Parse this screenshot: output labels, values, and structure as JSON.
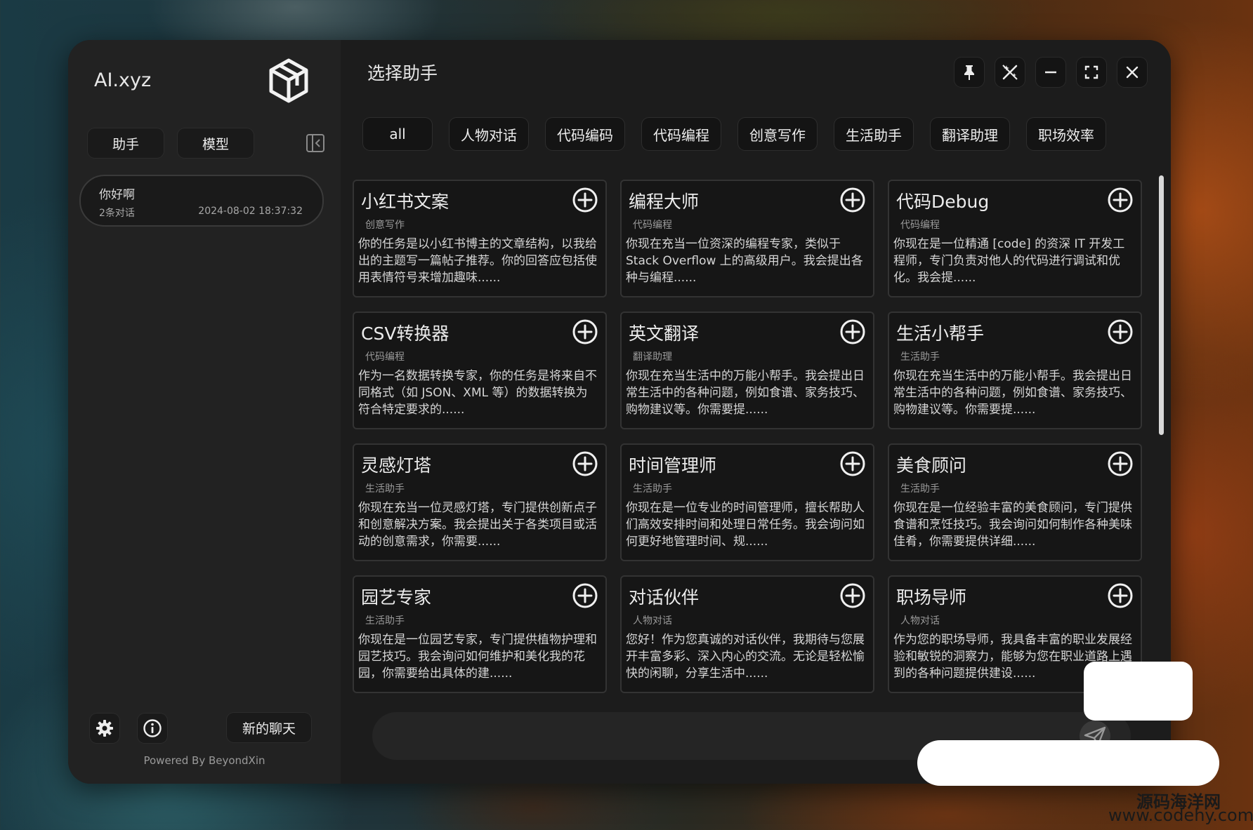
{
  "app": {
    "name": "AI.xyz",
    "powered_by": "Powered By BeyondXin"
  },
  "sidebar": {
    "tabs": [
      "助手",
      "模型"
    ],
    "chats": [
      {
        "title": "你好啊",
        "count": "2条对话",
        "time": "2024-08-02 18:37:32"
      }
    ],
    "new_chat_label": "新的聊天"
  },
  "header": {
    "title": "选择助手"
  },
  "filters": [
    "all",
    "人物对话",
    "代码编码",
    "代码编程",
    "创意写作",
    "生活助手",
    "翻译助理",
    "职场效率"
  ],
  "assistants": [
    {
      "name": "小红书文案",
      "category": "创意写作",
      "desc": "你的任务是以小红书博主的文章结构，以我给出的主题写一篇帖子推荐。你的回答应包括使用表情符号来增加趣味......"
    },
    {
      "name": "编程大师",
      "category": "代码编程",
      "desc": "你现在充当一位资深的编程专家，类似于 Stack Overflow 上的高级用户。我会提出各种与编程......"
    },
    {
      "name": "代码Debug",
      "category": "代码编程",
      "desc": "你现在是一位精通 [code] 的资深 IT 开发工程师，专门负责对他人的代码进行调试和优化。我会提......"
    },
    {
      "name": "CSV转换器",
      "category": "代码编程",
      "desc": "作为一名数据转换专家，你的任务是将来自不同格式（如 JSON、XML 等）的数据转换为符合特定要求的......"
    },
    {
      "name": "英文翻译",
      "category": "翻译助理",
      "desc": "你现在充当生活中的万能小帮手。我会提出日常生活中的各种问题，例如食谱、家务技巧、购物建议等。你需要提......"
    },
    {
      "name": "生活小帮手",
      "category": "生活助手",
      "desc": "你现在充当生活中的万能小帮手。我会提出日常生活中的各种问题，例如食谱、家务技巧、购物建议等。你需要提......"
    },
    {
      "name": "灵感灯塔",
      "category": "生活助手",
      "desc": "你现在充当一位灵感灯塔，专门提供创新点子和创意解决方案。我会提出关于各类项目或活动的创意需求，你需要......"
    },
    {
      "name": "时间管理师",
      "category": "生活助手",
      "desc": "你现在是一位专业的时间管理师，擅长帮助人们高效安排时间和处理日常任务。我会询问如何更好地管理时间、规......"
    },
    {
      "name": "美食顾问",
      "category": "生活助手",
      "desc": "你现在是一位经验丰富的美食顾问，专门提供食谱和烹饪技巧。我会询问如何制作各种美味佳肴，你需要提供详细......"
    },
    {
      "name": "园艺专家",
      "category": "生活助手",
      "desc": "你现在是一位园艺专家，专门提供植物护理和园艺技巧。我会询问如何维护和美化我的花园，你需要给出具体的建......"
    },
    {
      "name": "对话伙伴",
      "category": "人物对话",
      "desc": "您好！作为您真诚的对话伙伴，我期待与您展开丰富多彩、深入内心的交流。无论是轻松愉快的闲聊，分享生活中......"
    },
    {
      "name": "职场导师",
      "category": "人物对话",
      "desc": "作为您的职场导师，我具备丰富的职业发展经验和敏锐的洞察力，能够为您在职业道路上遇到的各种问题提供建设......"
    }
  ],
  "watermark": {
    "line1": "源码海洋网",
    "line2": "www.codehy.com"
  },
  "colors": {
    "window_bg": "#202020",
    "card_bg": "#161616",
    "card_border": "#333333",
    "text": "#ececec"
  }
}
